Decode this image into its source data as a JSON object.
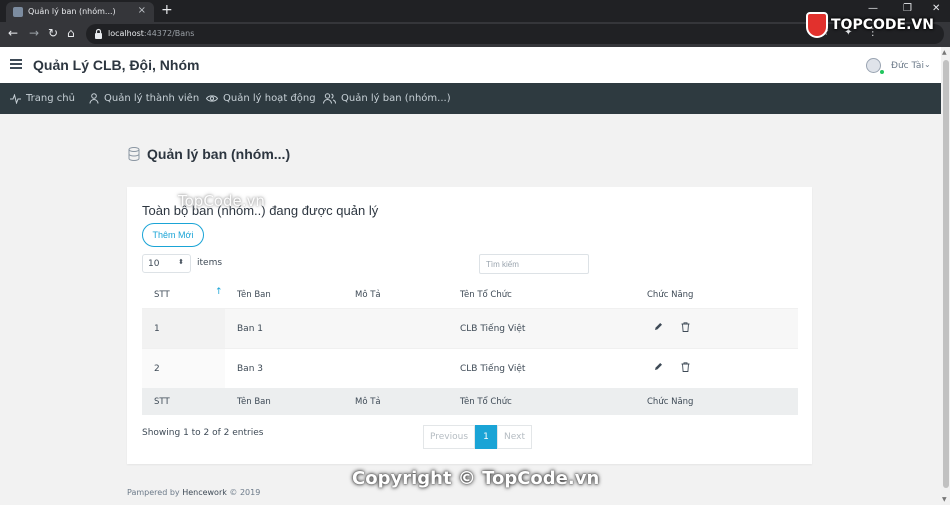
{
  "browser": {
    "tab_title": "Quản lý ban (nhóm...)",
    "tab_close": "×",
    "new_tab": "+",
    "url_host": "localhost",
    "url_rest": ":44372/Bans",
    "win_min": "—",
    "win_max": "❐",
    "win_close": "✕"
  },
  "watermark": {
    "logo_text": "TOPCODE.VN",
    "copyright": "Copyright © TopCode.vn",
    "overlay": "TopCode.vn"
  },
  "header": {
    "app_title": "Quản Lý CLB, Đội, Nhóm",
    "user_name": "Đức Tài"
  },
  "nav": {
    "items": [
      {
        "label": "Trang chủ",
        "icon": "activity-icon"
      },
      {
        "label": "Quản lý thành viên",
        "icon": "user-icon"
      },
      {
        "label": "Quản lý hoạt động",
        "icon": "eye-icon"
      },
      {
        "label": "Quản lý ban (nhóm...)",
        "icon": "users-icon"
      }
    ]
  },
  "page": {
    "heading": "Quản lý ban (nhóm...)"
  },
  "card": {
    "title": "Toàn bộ ban (nhóm..) đang được quản lý",
    "add_button": "Thêm Mới",
    "page_size": "10",
    "items_label": "items",
    "search_placeholder": "Tìm kiếm",
    "columns": [
      "STT",
      "Tên Ban",
      "Mô Tả",
      "Tên Tổ Chức",
      "Chức Năng"
    ],
    "rows": [
      {
        "stt": "1",
        "ten_ban": "Ban 1",
        "mo_ta": "",
        "ten_to_chuc": "CLB Tiếng Việt"
      },
      {
        "stt": "2",
        "ten_ban": "Ban 3",
        "mo_ta": "",
        "ten_to_chuc": "CLB Tiếng Việt"
      }
    ],
    "showing": "Showing 1 to 2 of 2 entries",
    "pager": {
      "previous": "Previous",
      "current": "1",
      "next": "Next"
    }
  },
  "footer": {
    "prefix": "Pampered by",
    "brand": "Hencework",
    "suffix": "© 2019"
  },
  "colors": {
    "accent": "#1aa4d6",
    "nav_bg": "#2e3a40",
    "page_bg": "#f2f2f2"
  }
}
